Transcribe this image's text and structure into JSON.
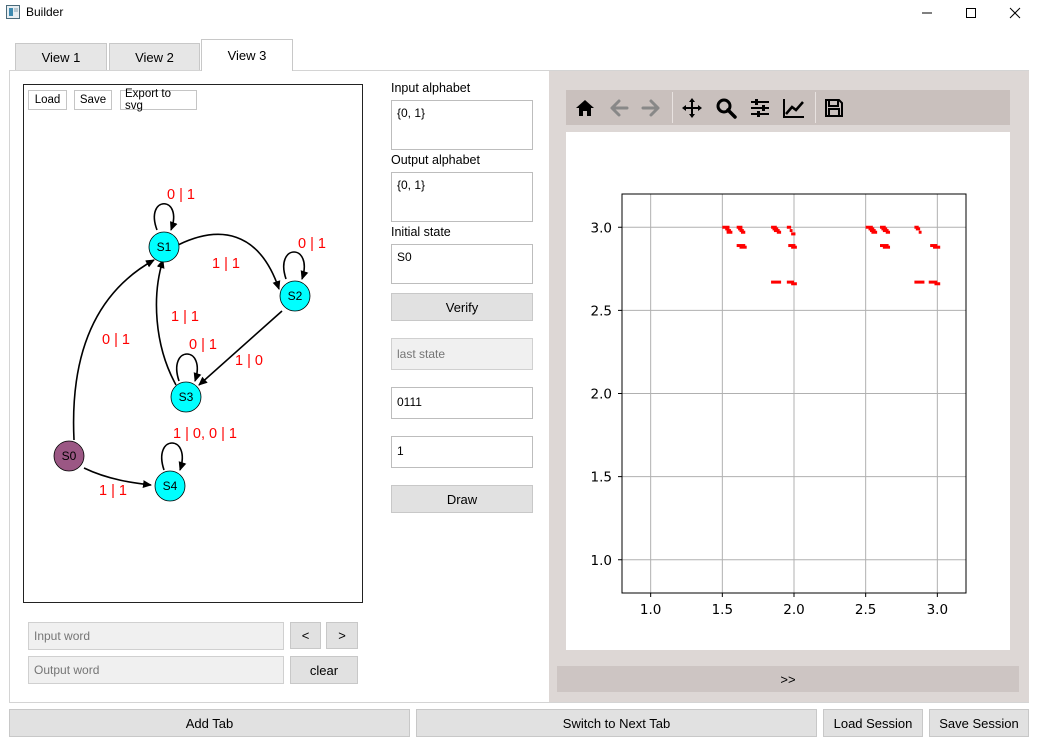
{
  "window": {
    "title": "Builder",
    "controls": {
      "minimize": "minimize-icon",
      "maximize": "maximize-icon",
      "close": "close-icon"
    }
  },
  "tabs": [
    {
      "label": "View 1",
      "active": false
    },
    {
      "label": "View 2",
      "active": false
    },
    {
      "label": "View 3",
      "active": true
    }
  ],
  "graph_toolbar": {
    "load": "Load",
    "save": "Save",
    "export": "Export to svg"
  },
  "graph": {
    "states": [
      {
        "id": "S0",
        "initial": true
      },
      {
        "id": "S1",
        "initial": false
      },
      {
        "id": "S2",
        "initial": false
      },
      {
        "id": "S3",
        "initial": false
      },
      {
        "id": "S4",
        "initial": false
      }
    ],
    "transitions": [
      {
        "from": "S1",
        "to": "S1",
        "label": "0 | 1"
      },
      {
        "from": "S1",
        "to": "S2",
        "label": "1 | 1"
      },
      {
        "from": "S2",
        "to": "S2",
        "label": "0 | 1"
      },
      {
        "from": "S2",
        "to": "S3",
        "label": "1 | 0"
      },
      {
        "from": "S3",
        "to": "S1",
        "label": "1 | 1"
      },
      {
        "from": "S3",
        "to": "S3",
        "label": "0 | 1"
      },
      {
        "from": "S0",
        "to": "S1",
        "label": "0 | 1"
      },
      {
        "from": "S0",
        "to": "S4",
        "label": "1 | 1"
      },
      {
        "from": "S4",
        "to": "S4",
        "label": "1 | 0, 0 | 1"
      }
    ],
    "colors": {
      "state": "#00ffff",
      "initial_state": "#9b5784",
      "edge_label": "#ff0000"
    }
  },
  "word_controls": {
    "input_word_placeholder": "Input word",
    "output_word_placeholder": "Output word",
    "prev": "<",
    "next": ">",
    "clear": "clear"
  },
  "form": {
    "input_alphabet_label": "Input alphabet",
    "input_alphabet_value": "{0, 1}",
    "output_alphabet_label": "Output alphabet",
    "output_alphabet_value": "{0, 1}",
    "initial_state_label": "Initial state",
    "initial_state_value": "S0",
    "verify": "Verify",
    "last_state_placeholder": "last state",
    "field1_value": "0111",
    "field2_value": "1",
    "draw": "Draw"
  },
  "plot_toolbar": [
    "home-icon",
    "back-icon",
    "forward-icon",
    "pan-icon",
    "zoom-icon",
    "configure-subplots-icon",
    "edit-axis-icon",
    "save-figure-icon"
  ],
  "toggle_button": ">>",
  "bottom_buttons": {
    "add_tab": "Add Tab",
    "switch_tab": "Switch to Next Tab",
    "load_session": "Load Session",
    "save_session": "Save Session"
  },
  "chart_data": {
    "type": "scatter",
    "xlim": [
      0.8,
      3.2
    ],
    "ylim": [
      0.8,
      3.2
    ],
    "xticks": [
      "1.0",
      "1.5",
      "2.0",
      "2.5",
      "3.0"
    ],
    "yticks": [
      "1.0",
      "1.5",
      "2.0",
      "2.5",
      "3.0"
    ],
    "grid": true,
    "marker_color": "#ff0000",
    "segments": [
      [
        1.5,
        3.0,
        1.55,
        3.0
      ],
      [
        1.52,
        2.99,
        1.55,
        2.99
      ],
      [
        1.53,
        2.98,
        1.56,
        2.98
      ],
      [
        1.53,
        2.97,
        1.57,
        2.97
      ],
      [
        1.6,
        3.0,
        1.64,
        3.0
      ],
      [
        1.61,
        2.99,
        1.64,
        2.99
      ],
      [
        1.62,
        2.98,
        1.65,
        2.98
      ],
      [
        1.63,
        2.97,
        1.66,
        2.97
      ],
      [
        1.6,
        2.89,
        1.66,
        2.89
      ],
      [
        1.62,
        2.88,
        1.67,
        2.88
      ],
      [
        1.84,
        3.0,
        1.88,
        3.0
      ],
      [
        1.85,
        2.99,
        1.89,
        2.99
      ],
      [
        1.86,
        2.98,
        1.9,
        2.98
      ],
      [
        1.88,
        2.97,
        1.91,
        2.97
      ],
      [
        1.95,
        3.0,
        1.98,
        3.0
      ],
      [
        1.97,
        2.98,
        1.99,
        2.98
      ],
      [
        1.98,
        2.96,
        2.01,
        2.96
      ],
      [
        1.96,
        2.89,
        2.01,
        2.89
      ],
      [
        1.98,
        2.88,
        2.02,
        2.88
      ],
      [
        1.84,
        2.67,
        1.91,
        2.67
      ],
      [
        1.95,
        2.67,
        2.0,
        2.67
      ],
      [
        1.98,
        2.66,
        2.02,
        2.66
      ],
      [
        2.5,
        3.0,
        2.55,
        3.0
      ],
      [
        2.52,
        2.99,
        2.56,
        2.99
      ],
      [
        2.53,
        2.98,
        2.57,
        2.98
      ],
      [
        2.54,
        2.97,
        2.58,
        2.97
      ],
      [
        2.6,
        3.0,
        2.64,
        3.0
      ],
      [
        2.61,
        2.99,
        2.65,
        2.99
      ],
      [
        2.62,
        2.98,
        2.66,
        2.98
      ],
      [
        2.64,
        2.97,
        2.67,
        2.97
      ],
      [
        2.6,
        2.89,
        2.66,
        2.89
      ],
      [
        2.62,
        2.88,
        2.67,
        2.88
      ],
      [
        2.84,
        3.0,
        2.87,
        3.0
      ],
      [
        2.85,
        2.99,
        2.88,
        2.99
      ],
      [
        2.87,
        2.97,
        2.89,
        2.97
      ],
      [
        2.95,
        2.89,
        3.0,
        2.89
      ],
      [
        2.97,
        2.88,
        3.02,
        2.88
      ],
      [
        2.84,
        2.67,
        2.91,
        2.67
      ],
      [
        2.94,
        2.67,
        3.0,
        2.67
      ],
      [
        2.98,
        2.66,
        3.02,
        2.66
      ]
    ]
  }
}
